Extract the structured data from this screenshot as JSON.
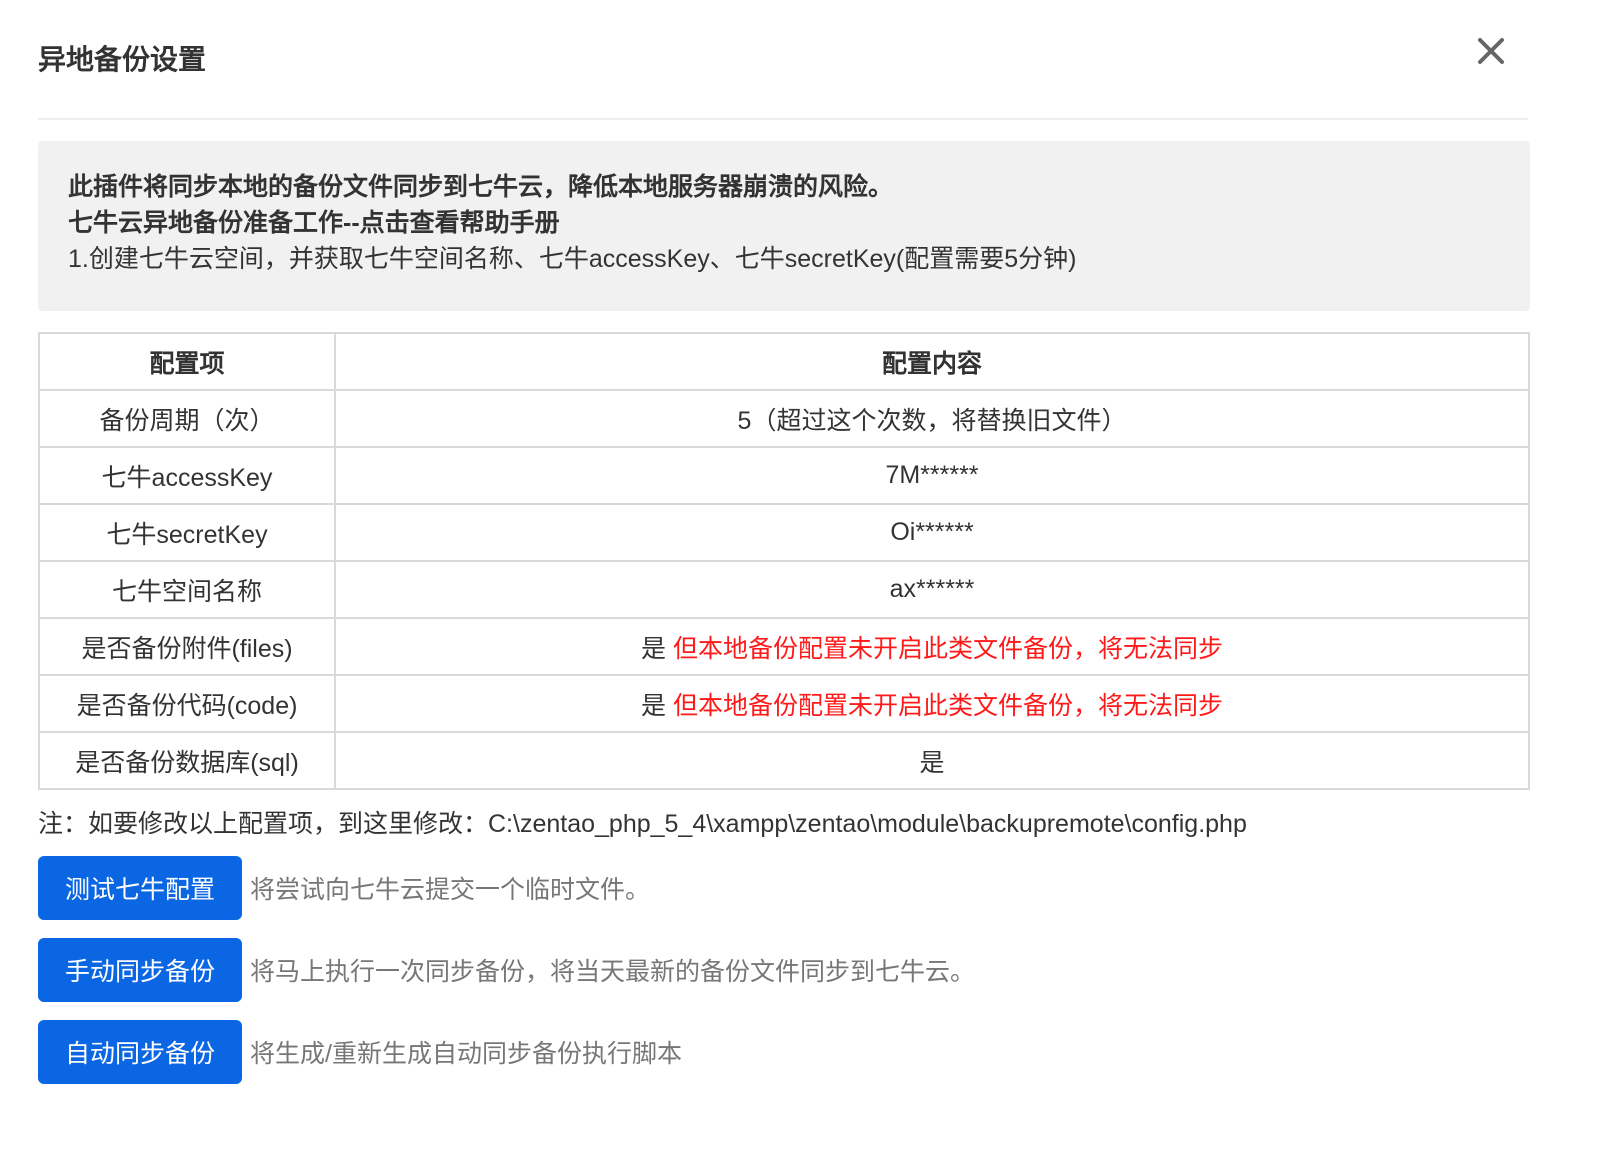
{
  "dialog": {
    "title": "异地备份设置",
    "close_icon": "close-icon"
  },
  "intro": {
    "line1": "此插件将同步本地的备份文件同步到七牛云，降低本地服务器崩溃的风险。",
    "line2_prefix": "七牛云异地备份准备工作--",
    "line2_link": "点击查看帮助手册",
    "line3": "1.创建七牛云空间，并获取七牛空间名称、七牛accessKey、七牛secretKey(配置需要5分钟)"
  },
  "table": {
    "headers": [
      "配置项",
      "配置内容"
    ],
    "rows": [
      {
        "item": "备份周期（次）",
        "value": "5（超过这个次数，将替换旧文件）",
        "warning": ""
      },
      {
        "item": "七牛accessKey",
        "value": "7M******",
        "warning": ""
      },
      {
        "item": "七牛secretKey",
        "value": "Oi******",
        "warning": ""
      },
      {
        "item": "七牛空间名称",
        "value": "ax******",
        "warning": ""
      },
      {
        "item": "是否备份附件(files)",
        "value": "是",
        "warning": "但本地备份配置未开启此类文件备份，将无法同步"
      },
      {
        "item": "是否备份代码(code)",
        "value": "是",
        "warning": "但本地备份配置未开启此类文件备份，将无法同步"
      },
      {
        "item": "是否备份数据库(sql)",
        "value": "是",
        "warning": ""
      }
    ]
  },
  "note": "注：如要修改以上配置项，到这里修改：C:\\zentao_php_5_4\\xampp\\zentao\\module\\backupremote\\config.php",
  "actions": [
    {
      "label": "测试七牛配置",
      "description": "将尝试向七牛云提交一个临时文件。"
    },
    {
      "label": "手动同步备份",
      "description": "将马上执行一次同步备份，将当天最新的备份文件同步到七牛云。"
    },
    {
      "label": "自动同步备份",
      "description": "将生成/重新生成自动同步备份执行脚本"
    }
  ],
  "colors": {
    "primary_button": "#0b66e4",
    "warning_text": "#ff1a1a",
    "intro_background": "#f1f1f1"
  }
}
